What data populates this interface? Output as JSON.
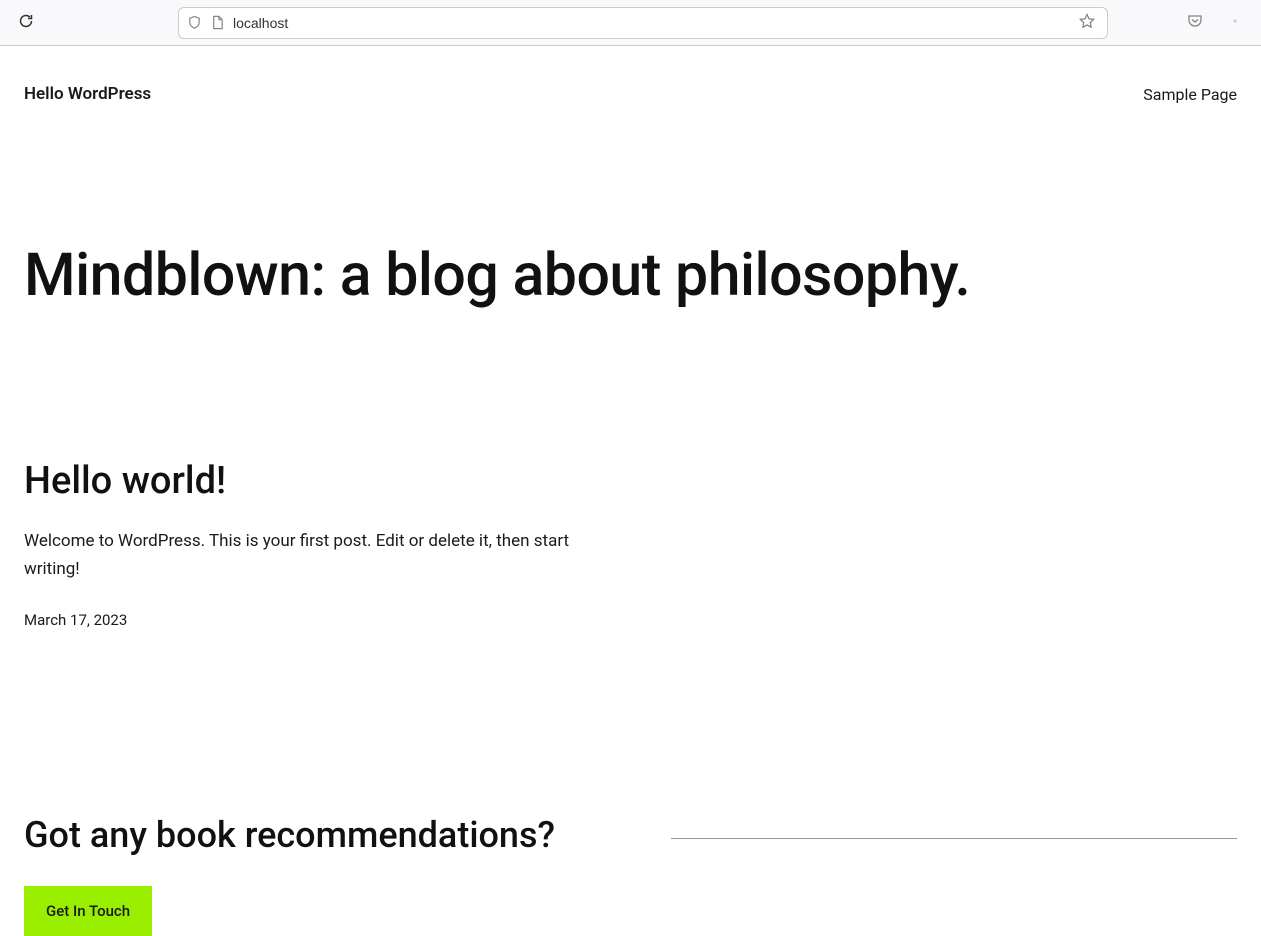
{
  "browser": {
    "url": "localhost"
  },
  "header": {
    "site_title": "Hello WordPress",
    "nav_links": [
      {
        "label": "Sample Page"
      }
    ]
  },
  "hero": {
    "title": "Mindblown: a blog about philosophy."
  },
  "posts": [
    {
      "title": "Hello world!",
      "excerpt": "Welcome to WordPress. This is your first post. Edit or delete it, then start writing!",
      "date": "March 17, 2023"
    }
  ],
  "cta": {
    "title": "Got any book recommendations?",
    "button_label": "Get In Touch"
  }
}
